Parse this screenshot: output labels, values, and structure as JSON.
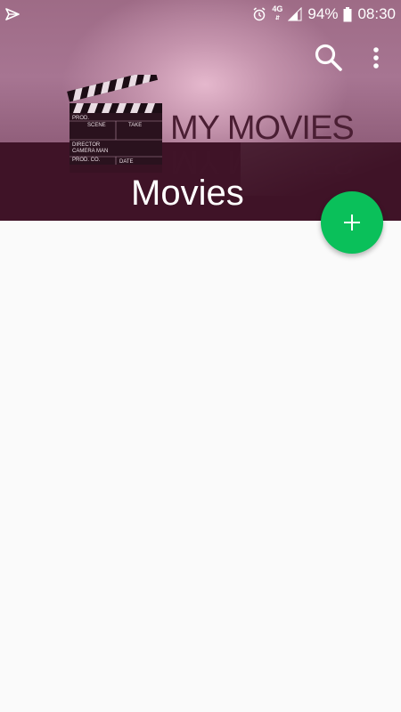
{
  "status_bar": {
    "left_icon": "share-icon",
    "alarm_icon": "alarm-icon",
    "network_type": "4G",
    "signal_icon": "signal-icon",
    "battery_percent": "94%",
    "battery_icon": "battery-icon",
    "time": "08:30"
  },
  "header": {
    "banner_text": "MY MOVIES",
    "title": "Movies",
    "illustration": "clapperboard-icon",
    "clapperboard_labels": {
      "prod": "PROD.",
      "scene": "SCENE",
      "take": "TAKE",
      "director": "DIRECTOR",
      "camera": "CAMERA MAN",
      "prod_co": "PROD. CO.",
      "date": "DATE"
    }
  },
  "toolbar": {
    "search_icon": "search-icon",
    "more_icon": "more-vert-icon"
  },
  "fab": {
    "icon": "plus-icon",
    "color": "#0ac05a"
  },
  "colors": {
    "header_dark": "#3f1327",
    "header_light": "#c493ac",
    "background": "#fafafa"
  }
}
